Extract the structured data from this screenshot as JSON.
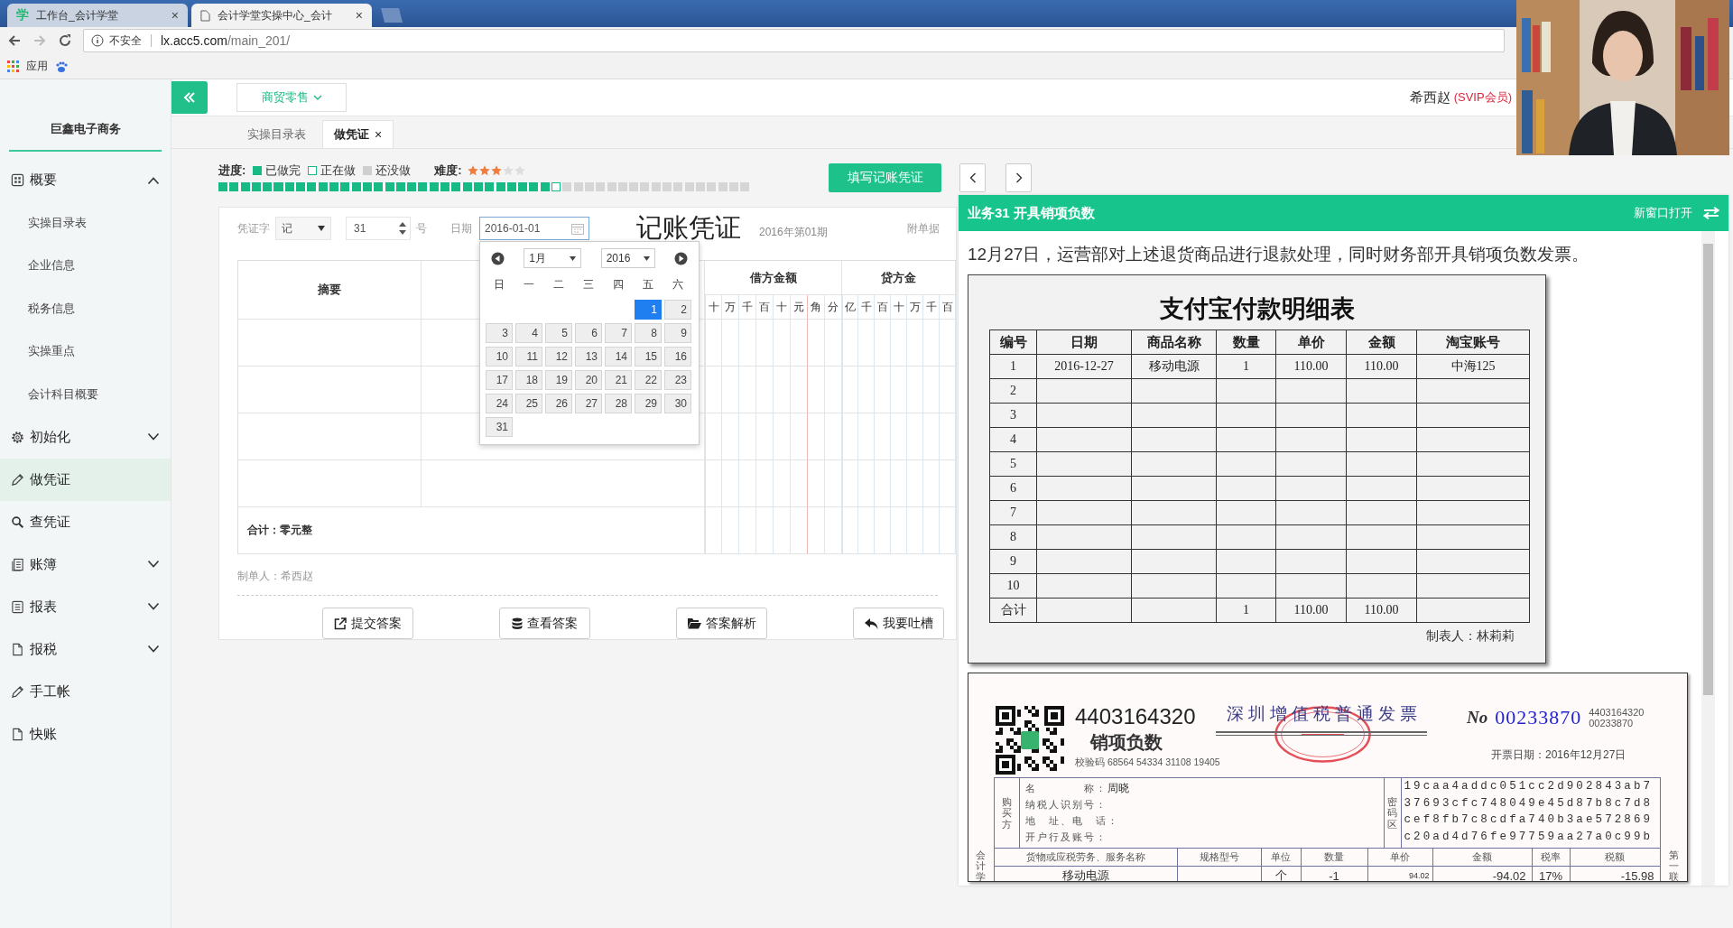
{
  "browser": {
    "tabs": [
      {
        "favicon": "学",
        "title": "工作台_会计学堂",
        "close": "×",
        "selected": false
      },
      {
        "title": "会计学堂实操中心_会计",
        "close": "×",
        "selected": true
      }
    ],
    "security": "不安全",
    "url_host": "lx.acc5.com",
    "url_path": "/main_201/",
    "bookmarks": [
      {
        "label": "应用"
      }
    ]
  },
  "company": "巨鑫电子商务",
  "sidebar": {
    "items": [
      {
        "label": "概要",
        "kind": "group",
        "expanded": true,
        "selected": false,
        "children": [
          {
            "label": "实操目录表",
            "selected": false
          },
          {
            "label": "企业信息",
            "selected": false
          },
          {
            "label": "税务信息",
            "selected": false
          },
          {
            "label": "实操重点",
            "selected": false
          },
          {
            "label": "会计科目概要",
            "selected": false
          }
        ]
      },
      {
        "label": "初始化",
        "kind": "group",
        "expanded": false,
        "selected": false
      },
      {
        "label": "做凭证",
        "kind": "link",
        "selected": true
      },
      {
        "label": "查凭证",
        "kind": "link",
        "selected": false
      },
      {
        "label": "账簿",
        "kind": "group",
        "expanded": false,
        "selected": false
      },
      {
        "label": "报表",
        "kind": "group",
        "expanded": false,
        "selected": false
      },
      {
        "label": "报税",
        "kind": "group",
        "expanded": false,
        "selected": false
      },
      {
        "label": "手工帐",
        "kind": "link",
        "selected": false
      },
      {
        "label": "快账",
        "kind": "link",
        "selected": false
      }
    ]
  },
  "header": {
    "industry": "商贸零售",
    "user": "希西赵",
    "membership": "(SVIP会员)"
  },
  "tabs": [
    {
      "label": "实操目录表",
      "selected": false
    },
    {
      "label": "做凭证",
      "close": "×",
      "selected": true
    }
  ],
  "progress": {
    "label": "进度:",
    "legend": [
      {
        "label": "已做完",
        "kind": "done"
      },
      {
        "label": "正在做",
        "kind": "current"
      },
      {
        "label": "还没做",
        "kind": "todo"
      }
    ],
    "level": 0.625,
    "difficulty_label": "难度:",
    "stars": 3
  },
  "fill_button": "填写记账凭证",
  "voucher": {
    "type_label": "凭证字",
    "type_value": "记",
    "number": "31",
    "number_suffix": "号",
    "date_label": "日期",
    "date": "2016-01-01",
    "title": "记账凭证",
    "period": "2016年第01期",
    "attachments_label": "附单据",
    "summary_header": "摘要",
    "debit_header": "借方金额",
    "credit_header": "贷方金",
    "debit_digits": [
      "十",
      "万",
      "千",
      "百",
      "十",
      "元",
      "角",
      "分"
    ],
    "credit_digits": [
      "亿",
      "千",
      "百",
      "十",
      "万",
      "千",
      "百"
    ],
    "total": "合计：零元整",
    "preparer": "制单人：希西赵",
    "actions": [
      {
        "label": "提交答案",
        "kind": "submit"
      },
      {
        "label": "查看答案",
        "kind": "view"
      },
      {
        "label": "答案解析",
        "kind": "analysis"
      },
      {
        "label": "我要吐槽",
        "kind": "feedback"
      }
    ]
  },
  "calendar": {
    "month": "1月",
    "year": "2016",
    "weekdays": [
      "日",
      "一",
      "二",
      "三",
      "四",
      "五",
      "六"
    ],
    "weeks": [
      [
        {
          "d": "1",
          "selected": true
        },
        {
          "d": "2",
          "selected": false
        }
      ],
      [
        {
          "d": "3",
          "selected": false
        },
        {
          "d": "4",
          "selected": false
        },
        {
          "d": "5",
          "selected": false
        },
        {
          "d": "6",
          "selected": false
        },
        {
          "d": "7",
          "selected": false
        },
        {
          "d": "8",
          "selected": false
        },
        {
          "d": "9",
          "selected": false
        }
      ],
      [
        {
          "d": "10",
          "selected": false
        },
        {
          "d": "11",
          "selected": false
        },
        {
          "d": "12",
          "selected": false
        },
        {
          "d": "13",
          "selected": false
        },
        {
          "d": "14",
          "selected": false
        },
        {
          "d": "15",
          "selected": false
        },
        {
          "d": "16",
          "selected": false
        }
      ],
      [
        {
          "d": "17",
          "selected": false
        },
        {
          "d": "18",
          "selected": false
        },
        {
          "d": "19",
          "selected": false
        },
        {
          "d": "20",
          "selected": false
        },
        {
          "d": "21",
          "selected": false
        },
        {
          "d": "22",
          "selected": false
        },
        {
          "d": "23",
          "selected": false
        }
      ],
      [
        {
          "d": "24",
          "selected": false
        },
        {
          "d": "25",
          "selected": false
        },
        {
          "d": "26",
          "selected": false
        },
        {
          "d": "27",
          "selected": false
        },
        {
          "d": "28",
          "selected": false
        },
        {
          "d": "29",
          "selected": false
        },
        {
          "d": "30",
          "selected": false
        }
      ],
      [
        {
          "d": "31",
          "selected": false
        }
      ]
    ]
  },
  "task_panel": {
    "title": "业务31 开具销项负数",
    "open_new": "新窗口打开",
    "description": "12月27日，运营部对上述退货商品进行退款处理，同时财务部开具销项负数发票。",
    "statement": {
      "title": "支付宝付款明细表",
      "columns": [
        "编号",
        "日期",
        "商品名称",
        "数量",
        "单价",
        "金额",
        "淘宝账号"
      ],
      "rows": [
        {
          "no": "1",
          "date": "2016-12-27",
          "item": "移动电源",
          "qty": "1",
          "price": "110.00",
          "amount": "110.00",
          "account": "中海125"
        },
        {
          "no": "2"
        },
        {
          "no": "3"
        },
        {
          "no": "4"
        },
        {
          "no": "5"
        },
        {
          "no": "6"
        },
        {
          "no": "7"
        },
        {
          "no": "8"
        },
        {
          "no": "9"
        },
        {
          "no": "10"
        },
        {
          "no": "合计",
          "qty": "1",
          "price": "110.00",
          "amount": "110.00"
        }
      ],
      "signer": "制表人：林莉莉"
    },
    "invoice": {
      "code": "4403164320",
      "kind_label": "销项负数",
      "check_code": "校验码 68564 54334 31108 19405",
      "title": "深圳增值税普通发票",
      "no_label": "No",
      "number": "00233870",
      "code_small": "4403164320",
      "number_small": "00233870",
      "date": "开票日期：2016年12月27日",
      "left_margin": "会计学",
      "right_margin": "第一联",
      "buyer_label": "购买方",
      "buyer_fields": [
        {
          "label": "名　　　　称：",
          "value": "周晓"
        },
        {
          "label": "纳税人识别号："
        },
        {
          "label": "地　址、电　话："
        },
        {
          "label": "开户行及账号："
        }
      ],
      "cipher_label": "密码区",
      "cipher": [
        "19caa4addc051cc2d902843ab7",
        "37693cfc748049e45d87b8c7d8",
        "cef8fb7c8cdfa740b3ae572869",
        "c20ad4d76fe97759aa27a0c99b"
      ],
      "item_columns": [
        "货物或应税劳务、服务名称",
        "规格型号",
        "单位",
        "数量",
        "单价",
        "金额",
        "税率",
        "税额"
      ],
      "item_rows": [
        {
          "name": "移动电源",
          "unit": "个",
          "qty": "-1",
          "price": "94.02",
          "amount": "-94.02",
          "rate": "17%",
          "tax": "-15.98"
        }
      ]
    }
  }
}
